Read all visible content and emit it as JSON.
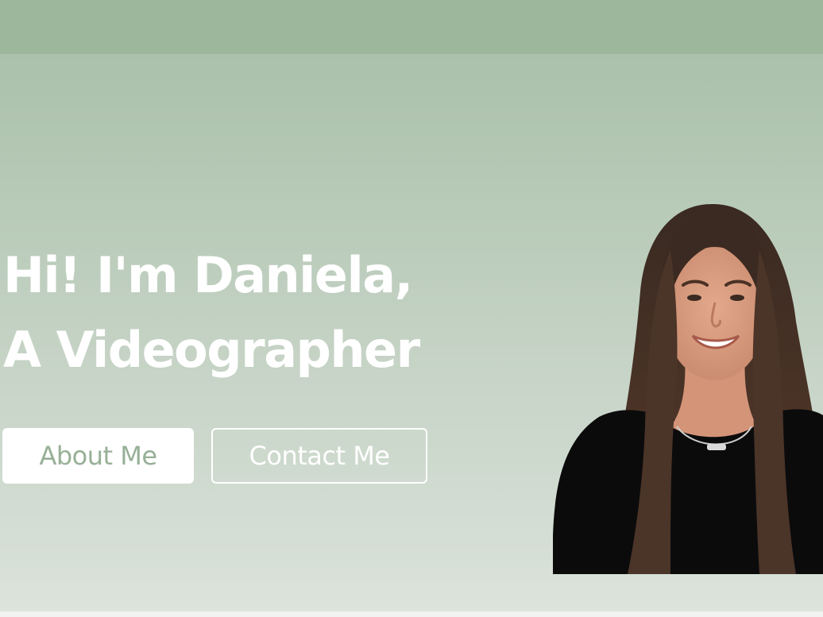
{
  "hero": {
    "title_line1": "Hi! I'm Daniela,",
    "title_line2": "A Videographer"
  },
  "buttons": {
    "about_label": "About Me",
    "contact_label": "Contact Me"
  },
  "colors": {
    "header_bar": "#9cb79c",
    "background_top": "#a7bea7",
    "background_bottom": "#dde4dd",
    "primary_text": "#ffffff",
    "about_button_text": "#97b097"
  },
  "images": {
    "portrait": "portrait-photo"
  }
}
